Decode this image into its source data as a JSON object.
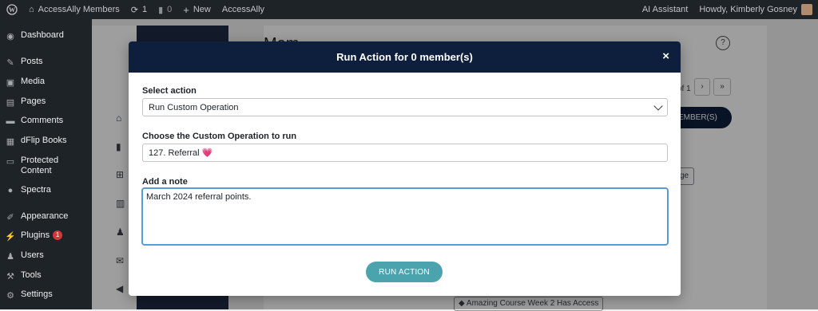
{
  "adminbar": {
    "site_name": "AccessAlly Members",
    "updates_count": "1",
    "comments_count": "0",
    "new_label": "New",
    "plugin_label": "AccessAlly",
    "ai_assistant": "AI Assistant",
    "howdy": "Howdy, Kimberly Gosney"
  },
  "sidebar": {
    "items": [
      {
        "label": "Dashboard",
        "icon": "dashboard-icon"
      },
      {
        "label": "Posts",
        "icon": "pin-icon"
      },
      {
        "label": "Media",
        "icon": "media-icon"
      },
      {
        "label": "Pages",
        "icon": "pages-icon"
      },
      {
        "label": "Comments",
        "icon": "comment-icon"
      },
      {
        "label": "dFlip Books",
        "icon": "book-icon"
      },
      {
        "label": "Protected Content",
        "icon": "folder-icon"
      },
      {
        "label": "Spectra",
        "icon": "spectra-icon"
      },
      {
        "label": "Appearance",
        "icon": "brush-icon"
      },
      {
        "label": "Plugins",
        "icon": "plugin-icon",
        "badge": "1"
      },
      {
        "label": "Users",
        "icon": "user-icon"
      },
      {
        "label": "Tools",
        "icon": "wrench-icon"
      },
      {
        "label": "Settings",
        "icon": "settings-icon"
      }
    ]
  },
  "background": {
    "heading_partial": "Mem",
    "pagination_text": "of 1",
    "next": "›",
    "last": "»",
    "members_btn": "EMBER(S)",
    "manage_btn": "ge",
    "tag": "Amazing Course Week 2 Has Access",
    "help": "?"
  },
  "modal": {
    "title": "Run Action for 0 member(s)",
    "close": "×",
    "select_action_label": "Select action",
    "select_action_value": "Run Custom Operation",
    "custom_op_label": "Choose the Custom Operation to run",
    "custom_op_value": "127. Referral 💗",
    "note_label": "Add a note",
    "note_value": "March 2024 referral points.",
    "run_button": "RUN ACTION"
  },
  "colors": {
    "admin_bar": "#1d2327",
    "modal_header": "#0d1f3c",
    "run_button": "#4ba3ae",
    "focus_border": "#5b9bd5"
  }
}
